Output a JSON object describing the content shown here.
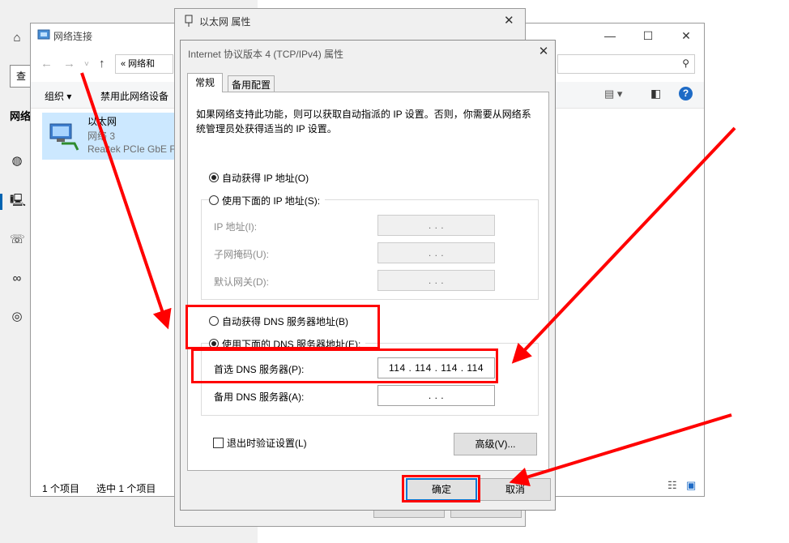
{
  "settings": {
    "left_search_label": "查",
    "network_label": "网络"
  },
  "net_window": {
    "title": "网络连接",
    "address": "«  网络和",
    "toolbar": {
      "organize": "组织 ▾",
      "disable": "禁用此网络设备"
    },
    "item": {
      "name": "以太网",
      "network": "网络 3",
      "adapter": "Realtek PCIe GbE F"
    },
    "status": {
      "count": "1 个项目",
      "selected": "选中 1 个项目"
    }
  },
  "eth_dialog": {
    "title": "以太网 属性",
    "close": "✕"
  },
  "ipv4_dialog": {
    "title": "Internet 协议版本 4 (TCP/IPv4) 属性",
    "close": "✕",
    "tabs": [
      "常规",
      "备用配置"
    ],
    "description": "如果网络支持此功能，则可以获取自动指派的 IP 设置。否则，你需要从网络系统管理员处获得适当的 IP 设置。",
    "ip_auto": "自动获得 IP 地址(O)",
    "ip_manual": "使用下面的 IP 地址(S):",
    "ip_fields": [
      {
        "label": "IP 地址(I):",
        "value": ".       .       ."
      },
      {
        "label": "子网掩码(U):",
        "value": ".       .       ."
      },
      {
        "label": "默认网关(D):",
        "value": ".       .       ."
      }
    ],
    "dns_auto": "自动获得 DNS 服务器地址(B)",
    "dns_manual": "使用下面的 DNS 服务器地址(E):",
    "dns_fields": [
      {
        "label": "首选 DNS 服务器(P):",
        "value": "114 . 114 . 114 . 114"
      },
      {
        "label": "备用 DNS 服务器(A):",
        "value": ".       .       ."
      }
    ],
    "validate_label": "退出时验证设置(L)",
    "advanced_label": "高级(V)...",
    "ok_label": "确定",
    "cancel_label": "取消"
  },
  "colors": {
    "annotation": "#ff0000",
    "selection": "#cce8ff",
    "accent": "#0063b1"
  }
}
